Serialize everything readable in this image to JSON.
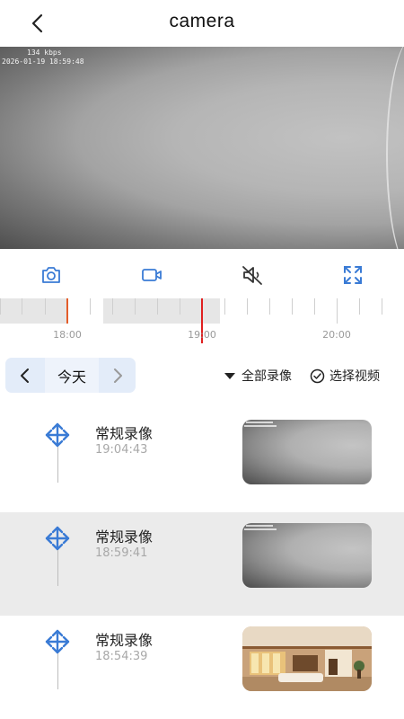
{
  "header": {
    "title": "camera"
  },
  "video": {
    "bitrate": "134 kbps",
    "timestamp": "2026-01-19 18:59:48"
  },
  "controls": {
    "items": [
      {
        "name": "snapshot-camera-icon",
        "color": "#3a7bd5"
      },
      {
        "name": "record-video-icon",
        "color": "#3a7bd5"
      },
      {
        "name": "mute-icon",
        "color": "#333333"
      },
      {
        "name": "fullscreen-icon",
        "color": "#3a7bd5"
      }
    ]
  },
  "timeline": {
    "labels": [
      "18:00",
      "19:00",
      "20:00"
    ],
    "current_time_color": "#e02020",
    "marker_color": "#e35d2a"
  },
  "datebar": {
    "label": "今天"
  },
  "filter": {
    "label": "全部录像"
  },
  "select": {
    "label": "选择视频"
  },
  "recordings": [
    {
      "type": "常规录像",
      "time": "19:04:43",
      "thumb": "gray",
      "selected": false
    },
    {
      "type": "常规录像",
      "time": "18:59:41",
      "thumb": "gray",
      "selected": true
    },
    {
      "type": "常规录像",
      "time": "18:54:39",
      "thumb": "room",
      "selected": false
    }
  ],
  "colors": {
    "accent": "#3a7bd5",
    "selected_row": "#ebebeb",
    "date_bg": "#e3ecf9"
  }
}
